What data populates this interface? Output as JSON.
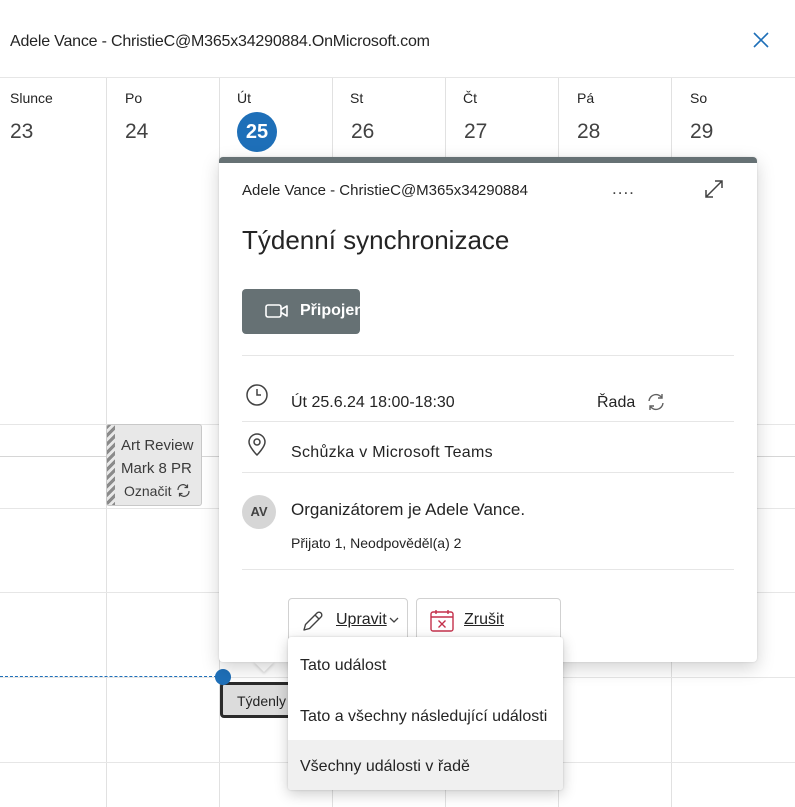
{
  "window": {
    "title": "Adele Vance - ChristieC@M365x34290884.OnMicrosoft.com"
  },
  "week": {
    "days": [
      {
        "name": "Slunce",
        "number": "23"
      },
      {
        "name": "Po",
        "number": "24"
      },
      {
        "name": "Út",
        "number": "25",
        "today": true
      },
      {
        "name": "St",
        "number": "26"
      },
      {
        "name": "Čt",
        "number": "27"
      },
      {
        "name": "Pá",
        "number": "28"
      },
      {
        "name": "So",
        "number": "29"
      }
    ]
  },
  "events": {
    "art_review": {
      "line1": "Art Review",
      "line2": "Mark 8 PR",
      "line3": "Označit"
    },
    "weekly": {
      "label": "Týdenly"
    }
  },
  "popup": {
    "account": "Adele Vance - ChristieC@M365x34290884",
    "more_label": "....",
    "title": "Týdenní synchronizace",
    "join_label": "Připojen",
    "when": "Út 25.6.24 18:00-18:30",
    "series_label": "Řada",
    "location": "Schůzka v Microsoft Teams",
    "avatar_initials": "AV",
    "organizer": "Organizátorem je Adele Vance.",
    "responses": "Přijato 1, Neodpověděl(a) 2",
    "edit_label": "Upravit",
    "cancel_label": "Zrušit"
  },
  "edit_menu": {
    "items": [
      {
        "label": "Tato událost"
      },
      {
        "label": "Tato a všechny následující události"
      },
      {
        "label": "Všechny události v řadě"
      }
    ]
  },
  "colors": {
    "accent": "#1e6fb8",
    "popup_header": "#667174",
    "cancel_red": "#c4314b"
  }
}
